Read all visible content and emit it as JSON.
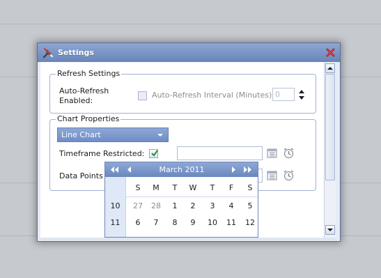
{
  "window": {
    "title": "Settings"
  },
  "refresh_settings": {
    "legend": "Refresh Settings",
    "auto_refresh_label_line1": "Auto-Refresh",
    "auto_refresh_label_line2": "Enabled:",
    "interval_label": "Auto-Refresh Interval (Minutes):",
    "interval_value": "0"
  },
  "chart_properties": {
    "legend": "Chart Properties",
    "chart_type": "Line Chart",
    "timeframe_label": "Timeframe Restricted:",
    "data_points_label": "Data Points S"
  },
  "calendar": {
    "month": "March 2011",
    "day_headers": [
      "S",
      "M",
      "T",
      "W",
      "T",
      "F",
      "S"
    ],
    "weeks": [
      {
        "week": "10",
        "days": [
          "27",
          "28",
          "1",
          "2",
          "3",
          "4",
          "5"
        ]
      },
      {
        "week": "11",
        "days": [
          "6",
          "7",
          "8",
          "9",
          "10",
          "11",
          "12"
        ]
      }
    ]
  },
  "colors": {
    "accent": "#6f8dc6",
    "title_bar": "#7b95c6",
    "close": "#c0161b"
  },
  "icons": {
    "title": "tools-icon",
    "close": "close-icon",
    "calendar": "calendar-icon",
    "clock": "alarm-clock-icon"
  }
}
